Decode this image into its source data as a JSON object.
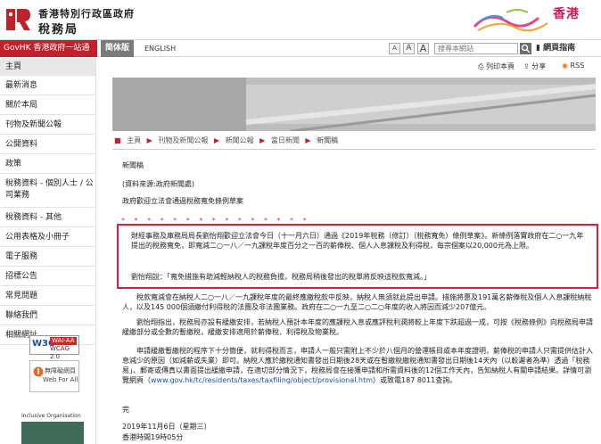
{
  "header": {
    "logo_line1": "香港特別行政區政府",
    "logo_line2": "稅務局",
    "brand_text": "香港"
  },
  "nav": {
    "gov_link": "GovHK 香港政府一站通",
    "lang_cn": "简体版",
    "lang_en": "ENGLISH",
    "font_small": "A",
    "font_mid": "A",
    "font_large": "A",
    "search_placeholder": "搜尋本網站",
    "sitemap": "網頁指南"
  },
  "sidebar": {
    "items": [
      {
        "label": "主頁"
      },
      {
        "label": "最新消息"
      },
      {
        "label": "關於本局"
      },
      {
        "label": "刊物及新聞公報"
      },
      {
        "label": "公開資料"
      },
      {
        "label": "政策"
      },
      {
        "label": "稅務資料 - 個別人士 / 公司業務"
      },
      {
        "label": "稅務資料 - 其他"
      },
      {
        "label": "公用表格及小冊子"
      },
      {
        "label": "電子服務"
      },
      {
        "label": "招標公告"
      },
      {
        "label": "常見問題"
      },
      {
        "label": "聯絡我們"
      },
      {
        "label": "相關網址"
      }
    ],
    "badge_wai_w3c": "W3C",
    "badge_wai_aa": "WAI-AA",
    "badge_wai_wcag": "WCAG 2.0",
    "badge_web_t1": "無障礙網頁",
    "badge_web_t2": "Web For All",
    "badge_inclusive": "Inclusive Organisation"
  },
  "toolbar": {
    "print": "列印本頁",
    "share": "分享",
    "rss": "RSS"
  },
  "breadcrumb": {
    "home": "主頁",
    "c1": "刊物及新聞公報",
    "c2": "新聞公報",
    "c3": "當日新聞",
    "c4": "新聞稿",
    "sep": "▶"
  },
  "content": {
    "heading": "新聞稿",
    "source": "(資料來源:政府新聞處)",
    "title": "政府歡迎立法會通過稅務寬免條例草案",
    "stars": "* * * * * * * * * * * * * * *",
    "hl_p1": "財經事務及庫務局局長劉怡翔歡迎立法會今日（十一月六日）通過《2019年稅務（修訂）（稅務寬免）條例草案》。新條例落實政府在二○一九年提出的稅務寬免，即寬減二○一八／一九課稅年度百分之一百的薪俸稅、個人入息課稅及利得稅，每宗個案以20,000元為上限。",
    "hl_p2": "劉怡翔說：「寬免措施有助減輕納稅人的稅務負擔，稅務局稍後發出的稅單將反映這稅款寬減。」",
    "p1": "稅款寬減會在納稅人二○一八／一九課稅年度的最終應繳稅款中反映，納稅人無須就此提出申請。措施將惠及191萬名薪俸稅及個人入息課稅納稅人，以及145 000個須繳付利得稅的法團及非法團業務。政府在二○一九至二○二○年度的收入將因而減少207億元。",
    "p2": "劉怡翔指出，稅務局亦設有緩繳安排，若納稅人預計本年度的應課稅入息或應評稅利潤將較上年度下跌超過一成，可按《稅務條例》向稅務局申請緩繳部分或全數的暫繳稅，緩繳安排適用於薪俸稅、利得稅及物業稅。",
    "p3a": "申請緩繳暫繳稅的程序下十分簡便，就利得稅而言，申請人一般只需附上不少於八個月的營運帳目或本年度證明，薪俸稅的申請人只需提供估計入息減少的原因（如減薪或失業）即可。納稅人應於繳稅通知書發出日期後28天或在暫繳稅繳稅通知書發出日期後14天內（以較遲者為準）透過「稅務易」、郵寄或傳真以書面提出緩繳申請，在適切部分情況下，稅務局會在接獲申請和所需資料後的12個工作天內，告知納稅人有關申請結果。詳情可瀏覽網頁（",
    "p3_link": "www.gov.hk/tc/residents/taxes/taxfiling/object/provisional.htm",
    "p3b": "）或致電187 8011查詢。",
    "end": "完",
    "date": "2019年11月6日（星期三）",
    "time": "香港時間19時05分"
  },
  "colors": {
    "gov_red": "#c0222c",
    "highlight_border": "#d81f3f",
    "brand_pink": "#d4145a"
  }
}
